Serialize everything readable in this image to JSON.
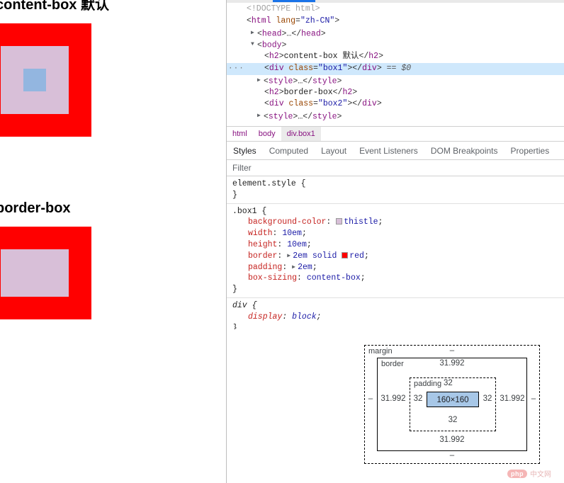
{
  "page_view": {
    "headings": [
      {
        "id": "content-box",
        "text": "content-box 默认"
      },
      {
        "id": "border-box",
        "text": "border-box"
      }
    ]
  },
  "devtools": {
    "dom_tree": [
      {
        "gutter": "",
        "tri": "",
        "indent": 0,
        "kind": "doctype",
        "text": "<!DOCTYPE html>"
      },
      {
        "gutter": "",
        "tri": "",
        "indent": 0,
        "kind": "open",
        "tag": "html",
        "attr_name": "lang",
        "attr_value": "\"zh-CN\""
      },
      {
        "gutter": "",
        "tri": "▶",
        "indent": 1,
        "kind": "collapsed",
        "tag": "head"
      },
      {
        "gutter": "",
        "tri": "▼",
        "indent": 1,
        "kind": "open",
        "tag": "body"
      },
      {
        "gutter": "",
        "tri": "",
        "indent": 2,
        "kind": "text_el",
        "tag": "h2",
        "text": "content-box 默认"
      },
      {
        "gutter": "···",
        "tri": "",
        "indent": 2,
        "kind": "selected",
        "tag": "div",
        "attr_name": "class",
        "attr_value": "\"box1\"",
        "suffix": "== $0"
      },
      {
        "gutter": "",
        "tri": "▶",
        "indent": 2,
        "kind": "collapsed",
        "tag": "style"
      },
      {
        "gutter": "",
        "tri": "",
        "indent": 2,
        "kind": "text_el",
        "tag": "h2",
        "text": "border-box"
      },
      {
        "gutter": "",
        "tri": "",
        "indent": 2,
        "kind": "empty_el",
        "tag": "div",
        "attr_name": "class",
        "attr_value": "\"box2\""
      },
      {
        "gutter": "",
        "tri": "▶",
        "indent": 2,
        "kind": "collapsed",
        "tag": "style"
      }
    ],
    "breadcrumb": [
      {
        "label": "html",
        "active": false
      },
      {
        "label": "body",
        "active": false
      },
      {
        "label": "div.box1",
        "active": true
      }
    ],
    "panel_tabs": [
      {
        "label": "Styles",
        "active": true
      },
      {
        "label": "Computed",
        "active": false
      },
      {
        "label": "Layout",
        "active": false
      },
      {
        "label": "Event Listeners",
        "active": false
      },
      {
        "label": "DOM Breakpoints",
        "active": false
      },
      {
        "label": "Properties",
        "active": false
      }
    ],
    "filter": {
      "placeholder": "Filter",
      "value": ""
    },
    "style_rules": [
      {
        "selector": "element.style",
        "inherited": false,
        "declarations": []
      },
      {
        "selector": ".box1",
        "inherited": false,
        "declarations": [
          {
            "property": "background-color",
            "value": "thistle",
            "swatch": "#d8bfd8",
            "expander": false
          },
          {
            "property": "width",
            "value": "10em",
            "swatch": null,
            "expander": false
          },
          {
            "property": "height",
            "value": "10em",
            "swatch": null,
            "expander": false
          },
          {
            "property": "border",
            "value": "2em solid ",
            "value2": "red",
            "swatch": "#ff0000",
            "expander": true
          },
          {
            "property": "padding",
            "value": "2em",
            "swatch": null,
            "expander": true
          },
          {
            "property": "box-sizing",
            "value": "content-box",
            "swatch": null,
            "expander": false
          }
        ]
      },
      {
        "selector": "div",
        "inherited": true,
        "declarations": [
          {
            "property": "display",
            "value": "block",
            "swatch": null,
            "expander": false
          }
        ]
      }
    ],
    "box_model": {
      "labels": {
        "margin": "margin",
        "border": "border",
        "padding": "padding"
      },
      "content": "160×160",
      "margin": {
        "top": "–",
        "right": "–",
        "bottom": "–",
        "left": "–"
      },
      "border": {
        "top": "31.992",
        "right": "31.992",
        "bottom": "31.992",
        "left": "31.992"
      },
      "padding": {
        "top": "32",
        "right": "32",
        "bottom": "32",
        "left": "32"
      }
    }
  },
  "watermark": {
    "badge": "php",
    "text": "中文网"
  },
  "colors": {
    "accent_blue": "#1a73e8",
    "selected_row": "#cfe8fc",
    "box_red": "#ff0000",
    "thistle": "#d8bfd8",
    "content_highlight": "#93b6e0",
    "box_model_content": "#a7c7e7"
  }
}
